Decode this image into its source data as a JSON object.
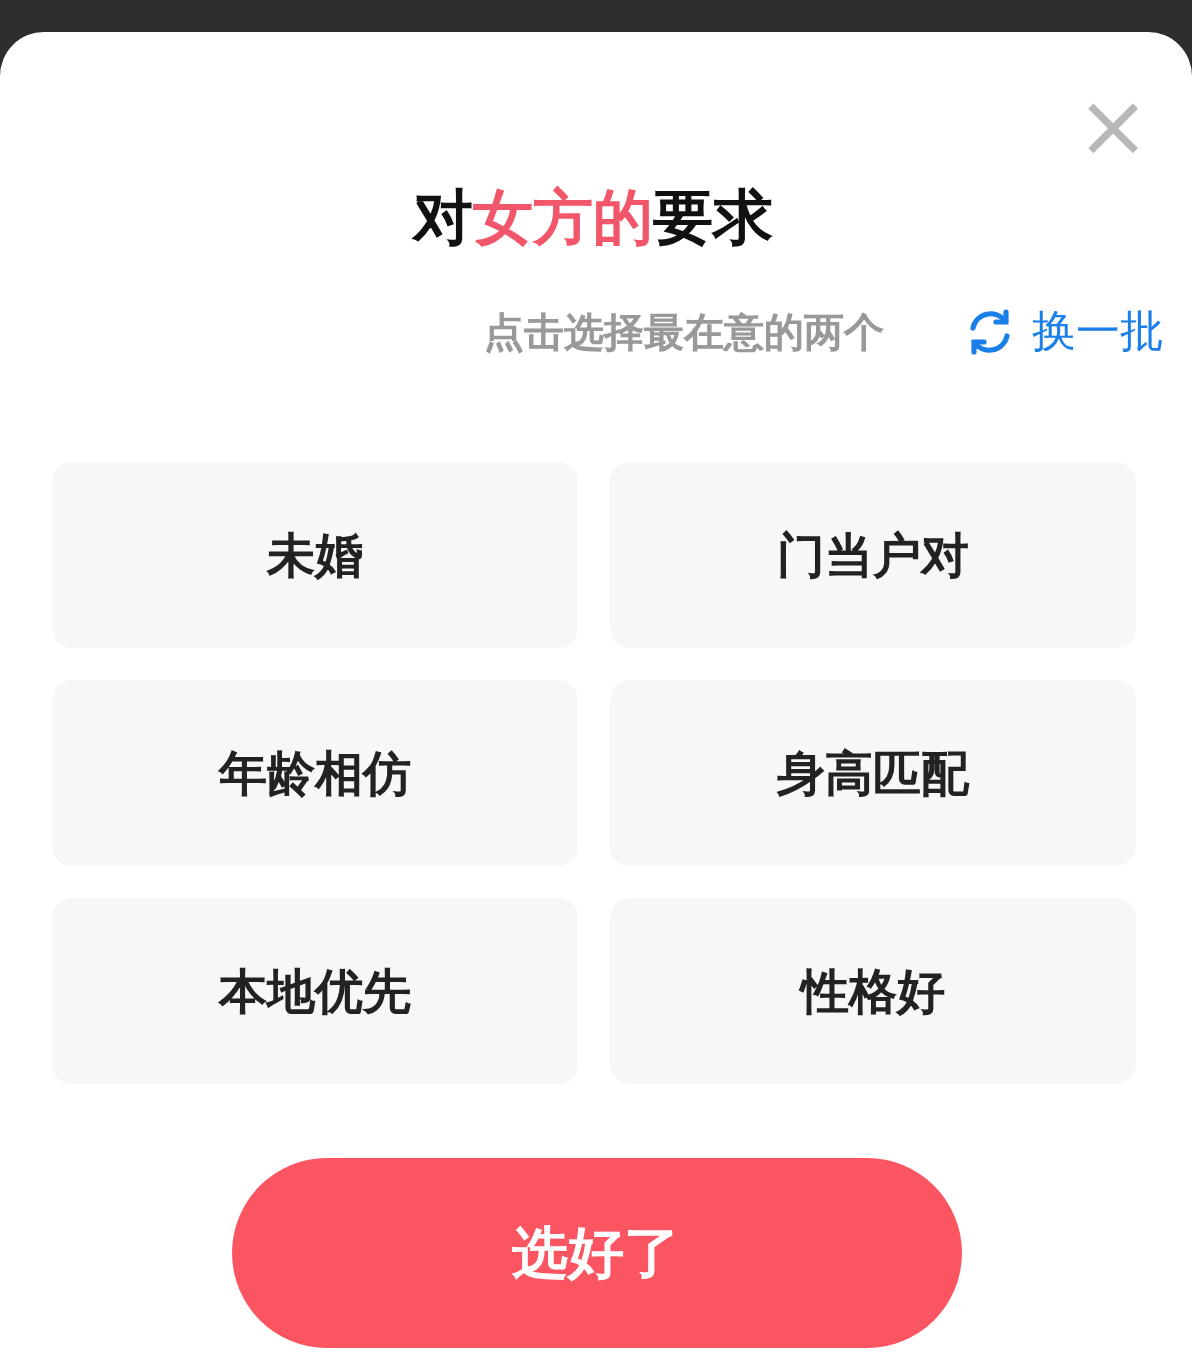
{
  "dialog": {
    "close_icon": "×",
    "title_parts": [
      {
        "text": "对",
        "highlight": false
      },
      {
        "text": "女方的",
        "highlight": true
      },
      {
        "text": "要求",
        "highlight": false
      }
    ],
    "hint": "点击选择最在意的两个",
    "refresh_link": "换一批",
    "options": [
      {
        "label": "未婚",
        "selected": false
      },
      {
        "label": "门当户对",
        "selected": false
      },
      {
        "label": "年龄相仿",
        "selected": false
      },
      {
        "label": "身高匹配",
        "selected": false
      },
      {
        "label": "本地优先",
        "selected": false
      },
      {
        "label": "性格好",
        "selected": false
      }
    ],
    "confirm_button": "选好了"
  }
}
